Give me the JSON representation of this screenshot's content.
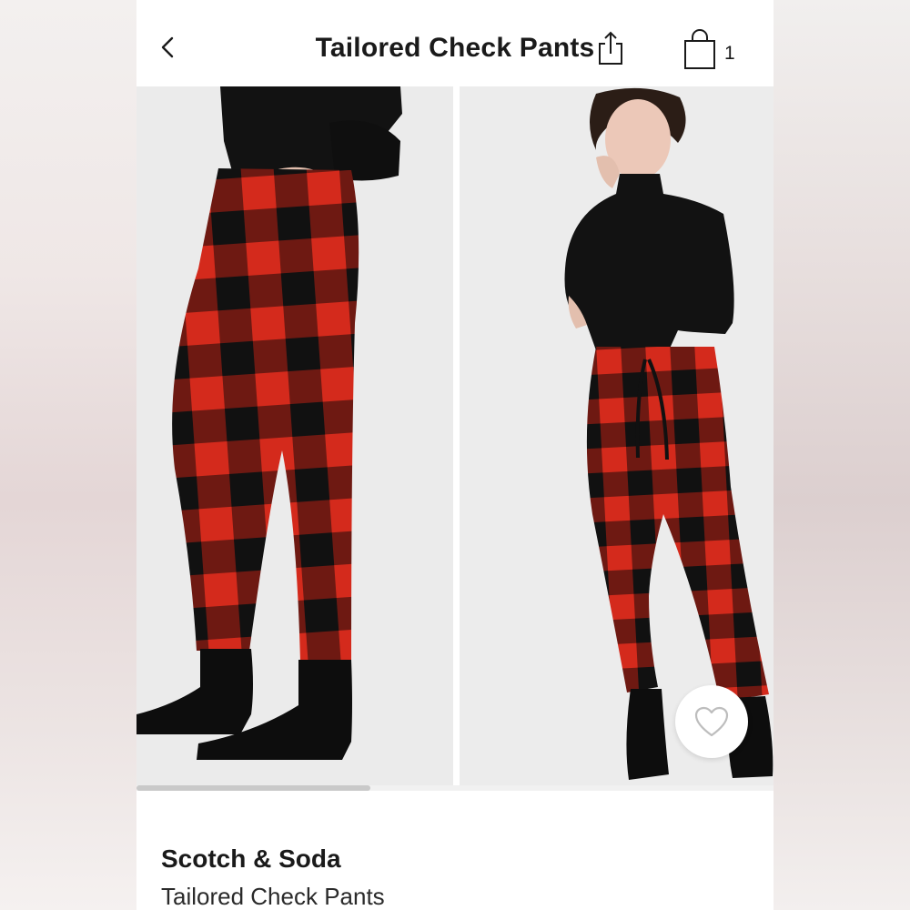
{
  "header": {
    "title": "Tailored Check Pants",
    "back_icon": "chevron-left-icon",
    "share_icon": "share-icon",
    "bag_icon": "shopping-bag-icon",
    "bag_count": "1"
  },
  "gallery": {
    "images": [
      "model-side-view",
      "model-front-view"
    ],
    "favorite_icon": "heart-icon",
    "scroll_progress": 0.37
  },
  "product": {
    "brand": "Scotch & Soda",
    "name": "Tailored Check Pants"
  },
  "colors": {
    "plaid_red": "#d42a1c",
    "plaid_black": "#141414",
    "background": "#ececec"
  }
}
